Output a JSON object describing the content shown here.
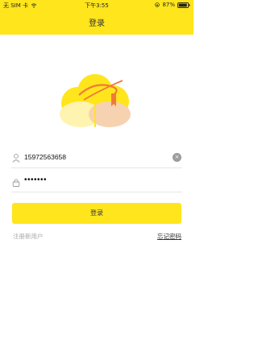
{
  "status_bar": {
    "carrier": "无 SIM 卡",
    "time": "下午3:55",
    "battery": "87%"
  },
  "nav": {
    "title": "登录"
  },
  "form": {
    "username_value": "15972563658",
    "password_masked": "•••••••"
  },
  "actions": {
    "login_label": "登录",
    "register_label": "注册新用户",
    "forgot_label": "忘记密码"
  },
  "colors": {
    "accent": "#FFE51C",
    "logo_cream": "#FFF3B0",
    "logo_peach": "#F7D2B0",
    "logo_orange": "#F07A3A"
  },
  "icons": {
    "wifi": "wifi-icon",
    "lock": "rotation-lock-icon",
    "battery": "battery-icon",
    "user": "user-icon",
    "password": "lock-icon",
    "clear": "clear-icon"
  }
}
